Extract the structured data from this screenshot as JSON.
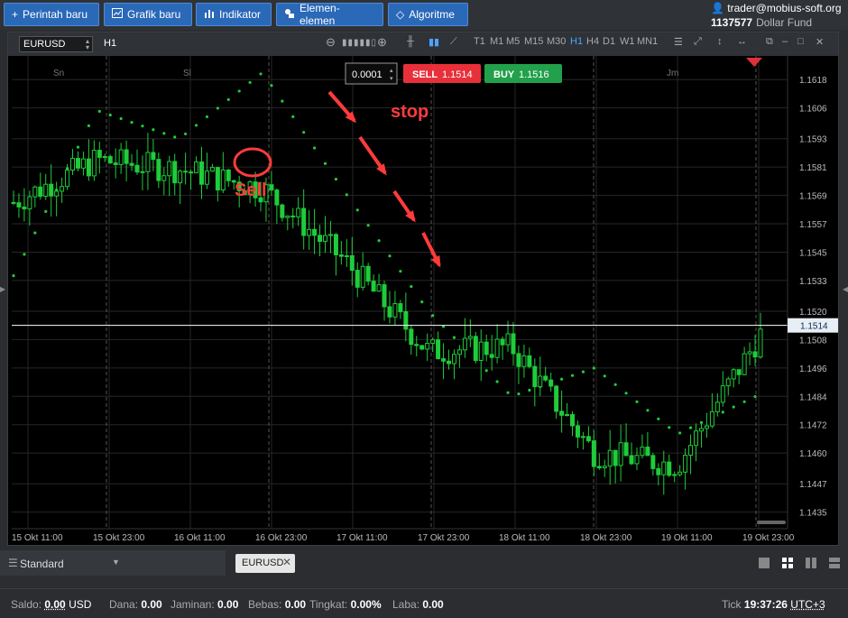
{
  "toolbar": {
    "new_order": "Perintah baru",
    "new_chart": "Grafik baru",
    "indicator": "Indikator",
    "elements": "Elemen-elemen",
    "algorithm": "Algoritme"
  },
  "account": {
    "user": "trader@mobius-soft.org",
    "number": "1137577",
    "fund": "Dollar Fund"
  },
  "chart": {
    "symbol": "EURUSD",
    "timeframe_badge": "H1",
    "timeframes": [
      "T1",
      "M1",
      "M5",
      "M15",
      "M30",
      "H1",
      "H4",
      "D1",
      "W1",
      "MN1"
    ],
    "active_timeframe": "H1",
    "lot": "0.0001",
    "sell_label": "SELL",
    "sell_price": "1.1514",
    "buy_label": "BUY",
    "buy_price": "1.1516",
    "current_price": "1.1514",
    "day_labels": [
      "Sn",
      "Sl",
      "Jm"
    ],
    "price_ticks": [
      "1.1618",
      "1.1606",
      "1.1593",
      "1.1581",
      "1.1569",
      "1.1557",
      "1.1545",
      "1.1533",
      "1.1520",
      "1.1508",
      "1.1496",
      "1.1484",
      "1.1472",
      "1.1460",
      "1.1447",
      "1.1435"
    ],
    "time_ticks": [
      "15 Okt 11:00",
      "15 Okt 23:00",
      "16 Okt 11:00",
      "16 Okt 23:00",
      "17 Okt 11:00",
      "17 Okt 23:00",
      "18 Okt 11:00",
      "18 Okt 23:00",
      "19 Okt 11:00",
      "19 Okt 23:00"
    ],
    "annotation_sell": "Sell",
    "annotation_stop": "stop",
    "colors": {
      "bull": "#1fcc3a",
      "bear": "#1fcc3a",
      "sar": "#1fcc3a",
      "annotation": "#ff3b3b",
      "sell_btn": "#e8303a",
      "buy_btn": "#22a04b"
    }
  },
  "chart_data": {
    "type": "candlestick",
    "symbol": "EURUSD",
    "timeframe": "H1",
    "ylim": [
      1.1428,
      1.1628
    ],
    "x": [
      "15 Okt 11:00",
      "15 Okt 23:00",
      "16 Okt 11:00",
      "16 Okt 23:00",
      "17 Okt 11:00",
      "17 Okt 23:00",
      "18 Okt 11:00",
      "18 Okt 23:00",
      "19 Okt 11:00",
      "19 Okt 23:00"
    ],
    "close_points": [
      [
        0,
        1.1566
      ],
      [
        1,
        1.1584
      ],
      [
        2,
        1.158
      ],
      [
        3,
        1.1572
      ],
      [
        4,
        1.1541
      ],
      [
        5,
        1.1503
      ],
      [
        6,
        1.1505
      ],
      [
        7,
        1.146
      ],
      [
        8,
        1.1455
      ],
      [
        9,
        1.151
      ]
    ],
    "parabolic_sar_markers": [
      [
        0,
        1.1535
      ],
      [
        1,
        1.1605
      ],
      [
        2,
        1.1593
      ],
      [
        3,
        1.1621
      ],
      [
        4,
        1.157
      ],
      [
        5,
        1.152
      ],
      [
        6,
        1.1484
      ],
      [
        7,
        1.1496
      ],
      [
        8,
        1.1468
      ],
      [
        9,
        1.1485
      ]
    ],
    "current_price": 1.1514
  },
  "bottom": {
    "profile": "Standard",
    "tab": "EURUSD"
  },
  "status": {
    "saldo_label": "Saldo:",
    "saldo": "0.00",
    "saldo_cur": "USD",
    "dana_label": "Dana:",
    "dana": "0.00",
    "jaminan_label": "Jaminan:",
    "jaminan": "0.00",
    "bebas_label": "Bebas:",
    "bebas": "0.00",
    "tingkat_label": "Tingkat:",
    "tingkat": "0.00%",
    "laba_label": "Laba:",
    "laba": "0.00",
    "tick_label": "Tick",
    "time": "19:37:26",
    "tz": "UTC+3"
  }
}
